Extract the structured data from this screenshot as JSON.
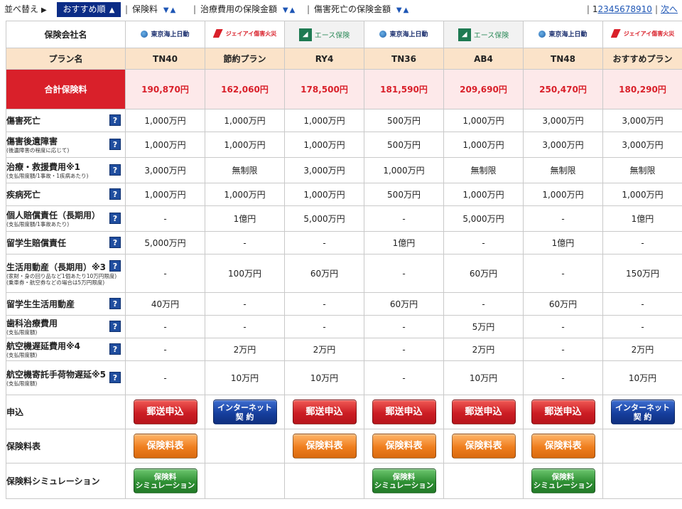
{
  "sortbar": {
    "label": "並べ替え",
    "active": "おすすめ順",
    "items": [
      {
        "label": "保険料"
      },
      {
        "label": "治療費用の保険金額"
      },
      {
        "label": "傷害死亡の保険金額"
      }
    ],
    "pages": [
      "1",
      "2",
      "3",
      "4",
      "5",
      "6",
      "7",
      "8",
      "9",
      "10"
    ],
    "current_page": "1",
    "next_label": "次へ"
  },
  "table": {
    "company_header": "保険会社名",
    "plan_header": "プラン名",
    "total_header": "合計保険料",
    "companies": [
      {
        "name": "東京海上日動",
        "logo": "tokio"
      },
      {
        "name": "ジェイアイ傷害火災",
        "logo": "jia"
      },
      {
        "name": "エース保険",
        "logo": "ace"
      },
      {
        "name": "東京海上日動",
        "logo": "tokio"
      },
      {
        "name": "エース保険",
        "logo": "ace"
      },
      {
        "name": "東京海上日動",
        "logo": "tokio"
      },
      {
        "name": "ジェイアイ傷害火災",
        "logo": "jia"
      }
    ],
    "plans": [
      "TN40",
      "節約プラン",
      "RY4",
      "TN36",
      "AB4",
      "TN48",
      "おすすめプラン"
    ],
    "totals": [
      "190,870円",
      "162,060円",
      "178,500円",
      "181,590円",
      "209,690円",
      "250,470円",
      "180,290円"
    ],
    "rows": [
      {
        "label": "傷害死亡",
        "sub": "",
        "values": [
          "1,000万円",
          "1,000万円",
          "1,000万円",
          "500万円",
          "1,000万円",
          "3,000万円",
          "3,000万円"
        ]
      },
      {
        "label": "傷害後遺障害",
        "sub": "(後遺障害の程度に応じて)",
        "values": [
          "1,000万円",
          "1,000万円",
          "1,000万円",
          "500万円",
          "1,000万円",
          "3,000万円",
          "3,000万円"
        ]
      },
      {
        "label": "治療・救援費用※1",
        "sub": "(支払限度額/1事故・1疾病あたり)",
        "values": [
          "3,000万円",
          "無制限",
          "3,000万円",
          "1,000万円",
          "無制限",
          "無制限",
          "無制限"
        ]
      },
      {
        "label": "疾病死亡",
        "sub": "",
        "values": [
          "1,000万円",
          "1,000万円",
          "1,000万円",
          "500万円",
          "1,000万円",
          "1,000万円",
          "1,000万円"
        ]
      },
      {
        "label": "個人賠償責任（長期用）",
        "sub": "(支払限度額/1事故あたり)",
        "values": [
          "-",
          "1億円",
          "5,000万円",
          "-",
          "5,000万円",
          "-",
          "1億円"
        ]
      },
      {
        "label": "留学生賠償責任",
        "sub": "",
        "values": [
          "5,000万円",
          "-",
          "-",
          "1億円",
          "-",
          "1億円",
          "-"
        ]
      },
      {
        "label": "生活用動産（長期用）※3",
        "sub": "(家財・身の回り品など1個あたり10万円限度)\n(乗車券・航空券などの場合は5万円限度)",
        "values": [
          "-",
          "100万円",
          "60万円",
          "-",
          "60万円",
          "-",
          "150万円"
        ]
      },
      {
        "label": "留学生生活用動産",
        "sub": "",
        "values": [
          "40万円",
          "-",
          "-",
          "60万円",
          "-",
          "60万円",
          "-"
        ]
      },
      {
        "label": "歯科治療費用",
        "sub": "(支払限度額)",
        "values": [
          "-",
          "-",
          "-",
          "-",
          "5万円",
          "-",
          "-"
        ]
      },
      {
        "label": "航空機遅延費用※4",
        "sub": "(支払限度額)",
        "values": [
          "-",
          "2万円",
          "2万円",
          "-",
          "2万円",
          "-",
          "2万円"
        ]
      },
      {
        "label": "航空機寄託手荷物遅延※5",
        "sub": "(支払限度額)",
        "values": [
          "-",
          "10万円",
          "10万円",
          "-",
          "10万円",
          "-",
          "10万円"
        ]
      }
    ],
    "apply_label": "申込",
    "rate_label": "保険料表",
    "sim_label": "保険料シミュレーション",
    "help_glyph": "?",
    "buttons": {
      "mail": "郵送申込",
      "net_line1": "インターネット",
      "net_line2": "契 約",
      "rate": "保険料表",
      "sim_line1": "保険料",
      "sim_line2": "シミュレーション"
    },
    "apply": [
      "mail",
      "net",
      "mail",
      "mail",
      "mail",
      "mail",
      "net"
    ],
    "rate": [
      true,
      false,
      true,
      true,
      true,
      true,
      false
    ],
    "sim": [
      true,
      false,
      false,
      true,
      false,
      true,
      false
    ]
  },
  "colors": {
    "sort_active_bg": "#0b2c86",
    "plan_bg": "#fbe3c9",
    "total_header_bg": "#d9202a",
    "total_value_bg": "#fde9ea",
    "total_value_text": "#d9202a",
    "help_icon": "#1f4d9e"
  }
}
